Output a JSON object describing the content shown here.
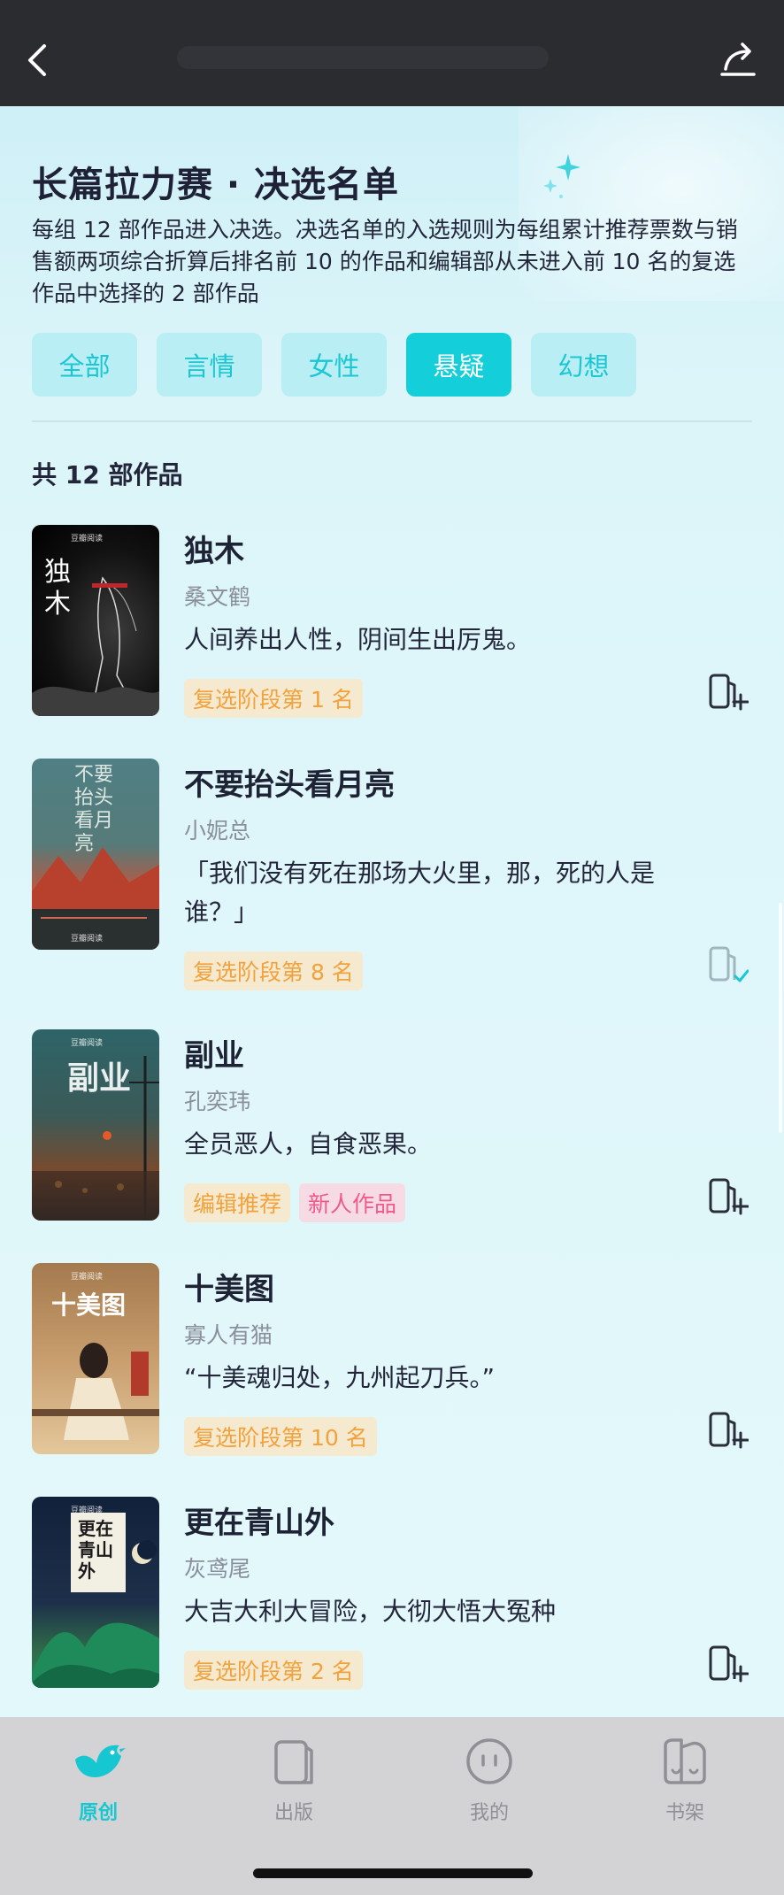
{
  "header": {
    "back_icon": "back-arrow-icon",
    "share_icon": "share-icon"
  },
  "page": {
    "title": "长篇拉力赛 · 决选名单",
    "intro": "每组 12 部作品进入决选。决选名单的入选规则为每组累计推荐票数与销售额两项综合折算后排名前 10 的作品和编辑部从未进入前 10 名的复选作品中选择的 2 部作品",
    "total_label": "共 12 部作品"
  },
  "filters": [
    {
      "label": "全部",
      "active": false
    },
    {
      "label": "言情",
      "active": false
    },
    {
      "label": "女性",
      "active": false
    },
    {
      "label": "悬疑",
      "active": true
    },
    {
      "label": "幻想",
      "active": false
    }
  ],
  "books": [
    {
      "title": "独木",
      "author": "桑文鹤",
      "desc": "人间养出人性，阴间生出厉鬼。",
      "tags": [
        {
          "text": "复选阶段第 1 名",
          "style": "orange"
        }
      ],
      "cover_text": "独木",
      "cover_publisher": "豆瓣阅读",
      "shelf_state": "add"
    },
    {
      "title": "不要抬头看月亮",
      "author": "小妮总",
      "desc": "「我们没有死在那场大火里，那，死的人是谁？」",
      "tags": [
        {
          "text": "复选阶段第 8 名",
          "style": "orange"
        }
      ],
      "cover_text": "不要抬头看月亮",
      "cover_publisher": "豆瓣阅读",
      "shelf_state": "added"
    },
    {
      "title": "副业",
      "author": "孔奕玮",
      "desc": "全员恶人，自食恶果。",
      "tags": [
        {
          "text": "编辑推荐",
          "style": "orange"
        },
        {
          "text": "新人作品",
          "style": "pink"
        }
      ],
      "cover_text": "副业",
      "cover_publisher": "豆瓣阅读",
      "shelf_state": "add"
    },
    {
      "title": "十美图",
      "author": "寡人有猫",
      "desc": "“十美魂归处，九州起刀兵。”",
      "tags": [
        {
          "text": "复选阶段第 10 名",
          "style": "orange"
        }
      ],
      "cover_text": "十美图",
      "cover_publisher": "豆瓣阅读",
      "shelf_state": "add"
    },
    {
      "title": "更在青山外",
      "author": "灰鸢尾",
      "desc": "大吉大利大冒险，大彻大悟大冤种",
      "tags": [
        {
          "text": "复选阶段第 2 名",
          "style": "orange"
        }
      ],
      "cover_text": "更在青山外",
      "cover_publisher": "豆瓣阅读",
      "shelf_state": "add"
    }
  ],
  "tabbar": [
    {
      "label": "原创",
      "icon": "bird-icon",
      "active": true
    },
    {
      "label": "出版",
      "icon": "book-icon",
      "active": false
    },
    {
      "label": "我的",
      "icon": "face-icon",
      "active": false
    },
    {
      "label": "书架",
      "icon": "bookshelf-icon",
      "active": false
    }
  ],
  "colors": {
    "accent": "#14cfd9",
    "tag_orange": "#f2a23c",
    "tag_pink": "#ef5a8a",
    "header_bg": "#2b2c30"
  }
}
